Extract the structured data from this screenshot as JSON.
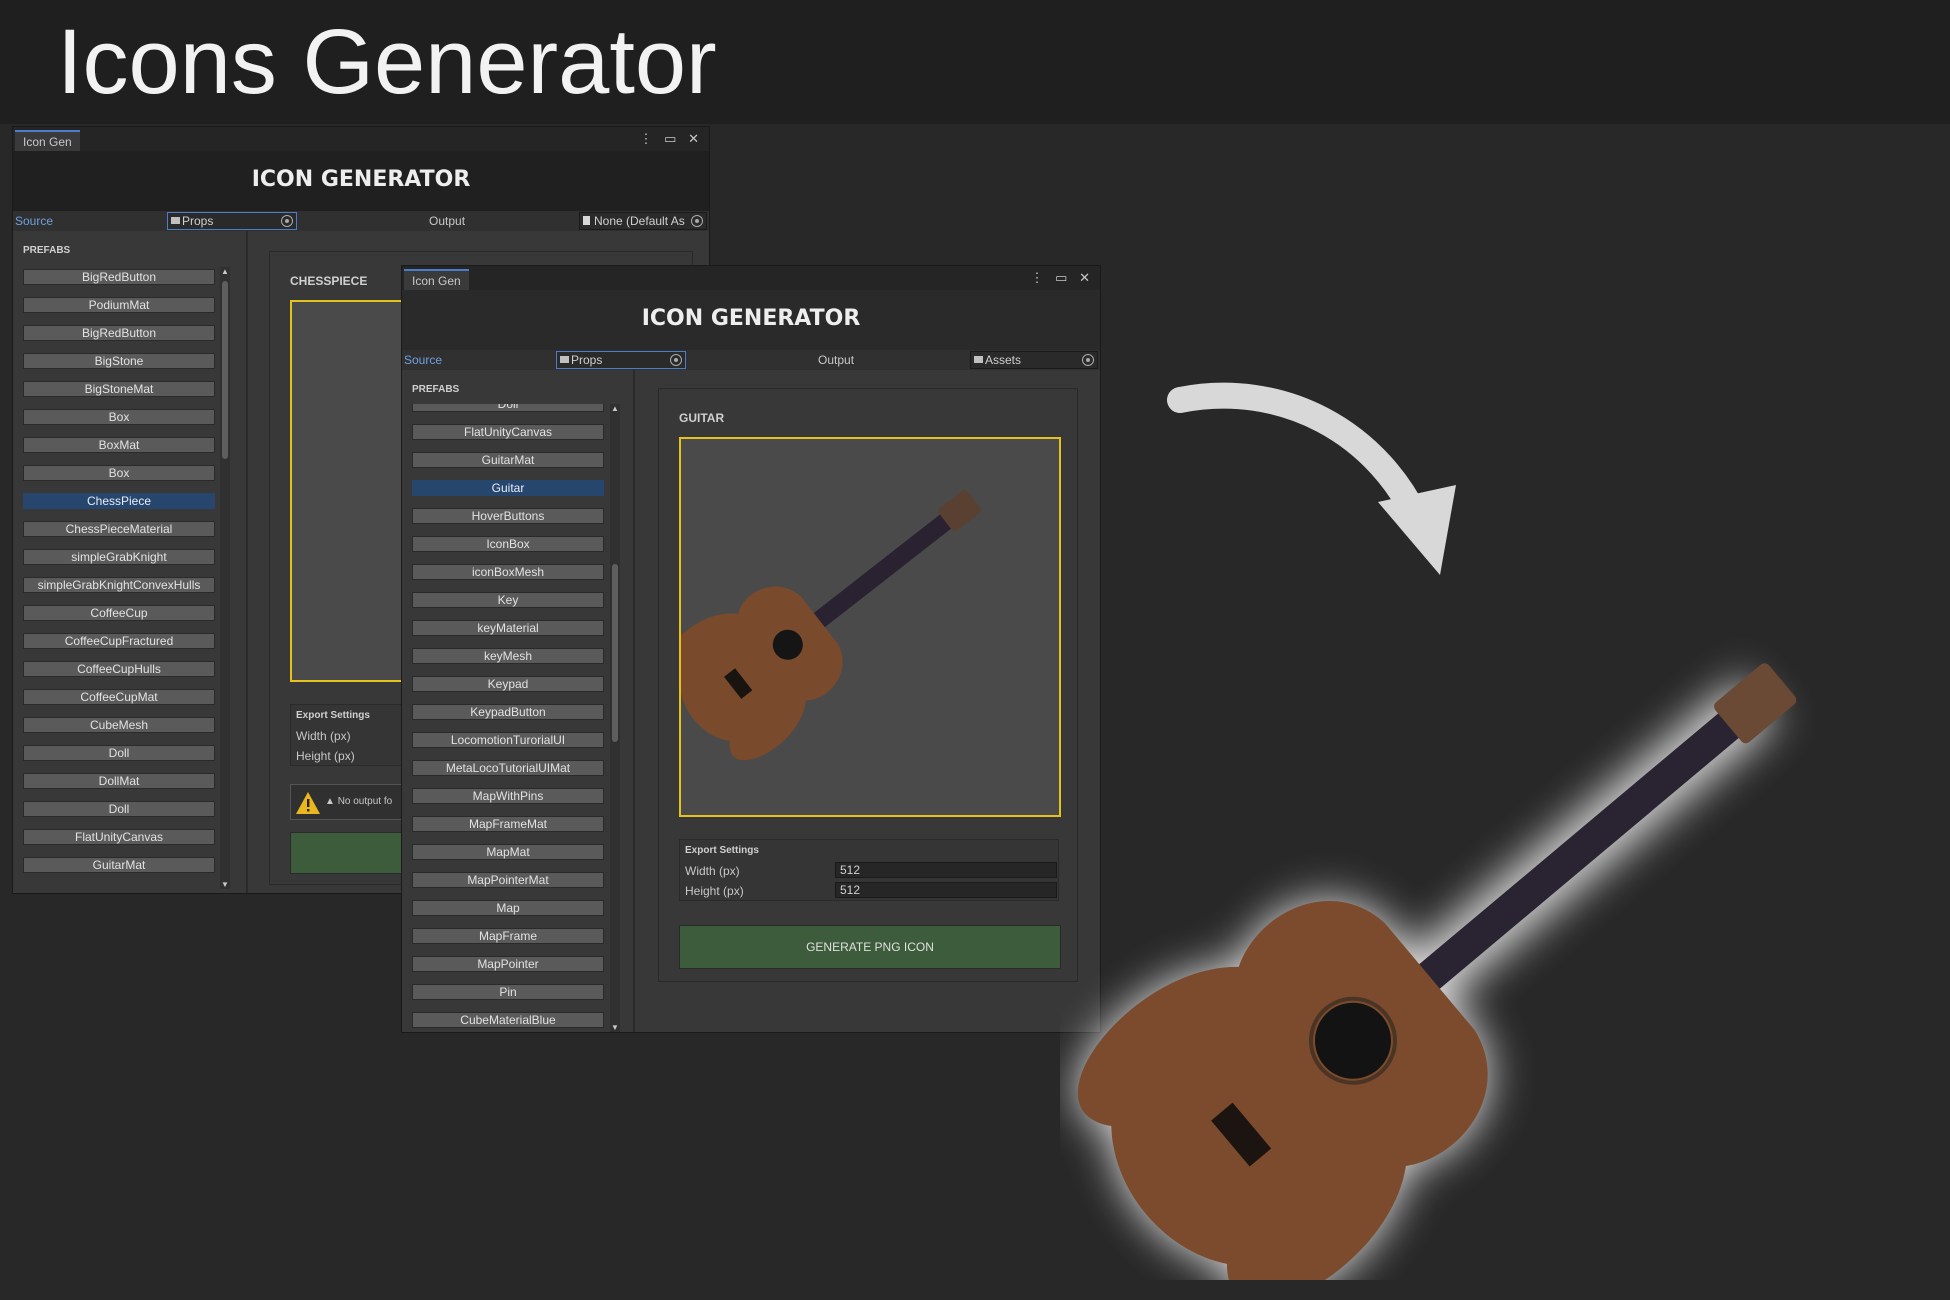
{
  "banner": {
    "title": "Icons Generator"
  },
  "window_back": {
    "tab_label": "Icon Gen",
    "window_controls": "⋮ ▭ ✕",
    "header_title": "ICON GENERATOR",
    "source_label": "Source",
    "source_value": "Props",
    "output_label": "Output",
    "output_value": "None (Default As",
    "prefabs_label": "PREFABS",
    "items": [
      "BigRedButton",
      "PodiumMat",
      "BigRedButton",
      "BigStone",
      "BigStoneMat",
      "Box",
      "BoxMat",
      "Box",
      "ChessPiece",
      "ChessPieceMaterial",
      "simpleGrabKnight",
      "simpleGrabKnightConvexHulls",
      "CoffeeCup",
      "CoffeeCupFractured",
      "CoffeeCupHulls",
      "CoffeeCupMat",
      "CubeMesh",
      "Doll",
      "DollMat",
      "Doll",
      "FlatUnityCanvas",
      "GuitarMat"
    ],
    "selected_item": "ChessPiece",
    "selected_name": "CHESSPIECE",
    "export_settings_label": "Export Settings",
    "width_label": "Width (px)",
    "height_label": "Height (px)",
    "warning_text": "No output fo"
  },
  "window_front": {
    "tab_label": "Icon Gen",
    "window_controls": "⋮ ▭ ✕",
    "header_title": "ICON GENERATOR",
    "source_label": "Source",
    "source_value": "Props",
    "output_label": "Output",
    "output_value": "Assets",
    "prefabs_label": "PREFABS",
    "items": [
      "Doll",
      "FlatUnityCanvas",
      "GuitarMat",
      "Guitar",
      "HoverButtons",
      "IconBox",
      "iconBoxMesh",
      "Key",
      "keyMaterial",
      "keyMesh",
      "Keypad",
      "KeypadButton",
      "LocomotionTurorialUI",
      "MetaLocoTutorialUIMat",
      "MapWithPins",
      "MapFrameMat",
      "MapMat",
      "MapPointerMat",
      "Map",
      "MapFrame",
      "MapPointer",
      "Pin",
      "CubeMaterialBlue"
    ],
    "selected_item": "Guitar",
    "selected_name": "GUITAR",
    "export_settings_label": "Export Settings",
    "width_label": "Width (px)",
    "width_value": "512",
    "height_label": "Height (px)",
    "height_value": "512",
    "generate_label": "GENERATE PNG ICON"
  },
  "colors": {
    "background": "#282828",
    "banner": "#1f1f1f",
    "selection": "#27466e",
    "preview_border": "#e5c21d",
    "generate_button": "#3c5c3c",
    "source_label": "#6fa0e0"
  },
  "icons": [
    "more-icon",
    "maximize-icon",
    "close-icon",
    "folder-icon",
    "document-icon",
    "target-icon",
    "warning-icon",
    "arrow-icon",
    "guitar-image"
  ]
}
